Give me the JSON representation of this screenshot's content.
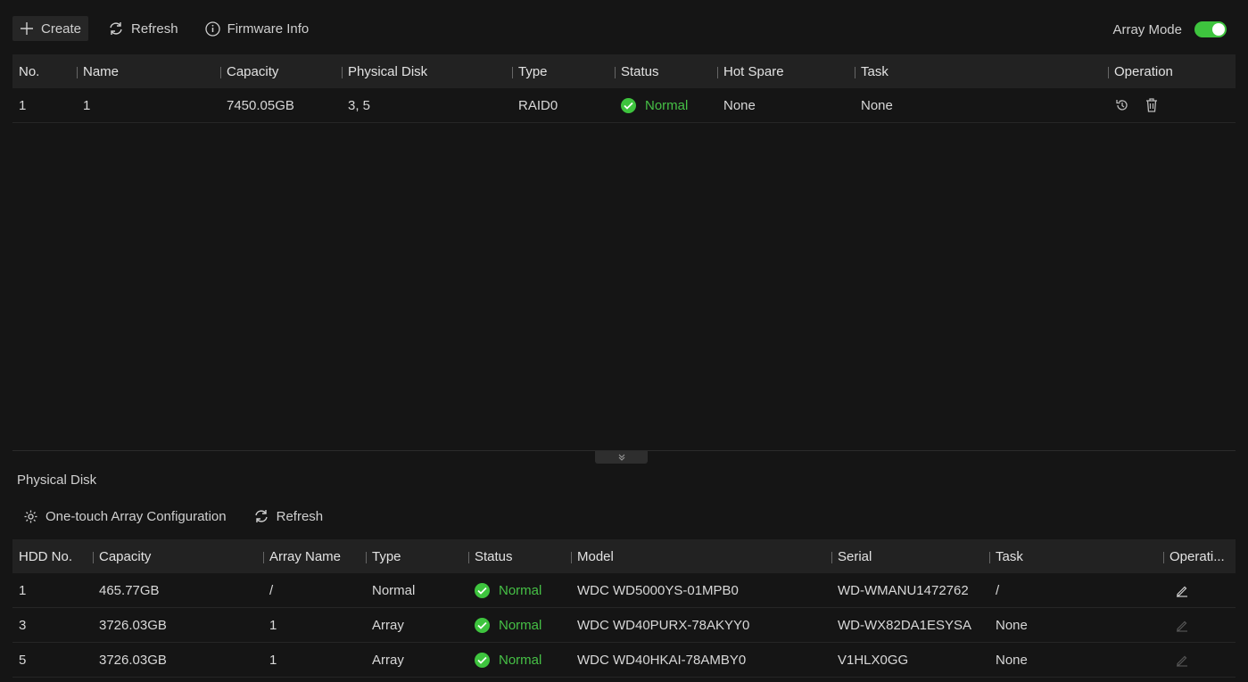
{
  "toolbar": {
    "create_label": "Create",
    "refresh_label": "Refresh",
    "firmware_label": "Firmware Info"
  },
  "array_mode": {
    "label": "Array Mode",
    "enabled": true
  },
  "array_table": {
    "headers": [
      "No.",
      "Name",
      "Capacity",
      "Physical Disk",
      "Type",
      "Status",
      "Hot Spare",
      "Task",
      "Operation"
    ],
    "rows": [
      {
        "no": "1",
        "name": "1",
        "capacity": "7450.05GB",
        "physical_disk": "3, 5",
        "type": "RAID0",
        "status": "Normal",
        "hot_spare": "None",
        "task": "None"
      }
    ]
  },
  "physical_disk": {
    "title": "Physical Disk",
    "one_touch_label": "One-touch Array Configuration",
    "refresh_label": "Refresh",
    "headers": [
      "HDD No.",
      "Capacity",
      "Array Name",
      "Type",
      "Status",
      "Model",
      "Serial",
      "Task",
      "Operati..."
    ],
    "rows": [
      {
        "hdd_no": "1",
        "capacity": "465.77GB",
        "array_name": "/",
        "type": "Normal",
        "status": "Normal",
        "model": "WDC WD5000YS-01MPB0",
        "serial": "WD-WMANU1472762",
        "task": "/"
      },
      {
        "hdd_no": "3",
        "capacity": "3726.03GB",
        "array_name": "1",
        "type": "Array",
        "status": "Normal",
        "model": "WDC WD40PURX-78AKYY0",
        "serial": "WD-WX82DA1ESYSA",
        "task": "None"
      },
      {
        "hdd_no": "5",
        "capacity": "3726.03GB",
        "array_name": "1",
        "type": "Array",
        "status": "Normal",
        "model": "WDC WD40HKAI-78AMBY0",
        "serial": "V1HLX0GG",
        "task": "None"
      }
    ]
  },
  "colors": {
    "accent": "#3ec43e",
    "background": "#151515",
    "header_bg": "#222222"
  },
  "icons": {
    "create": "plus-icon",
    "refresh": "refresh-icon",
    "firmware": "info-icon",
    "status_ok": "check-circle-icon",
    "rebuild": "rebuild-icon",
    "delete": "trash-icon",
    "edit": "pencil-icon",
    "settings": "gear-icon",
    "collapse": "double-chevron-down-icon"
  }
}
